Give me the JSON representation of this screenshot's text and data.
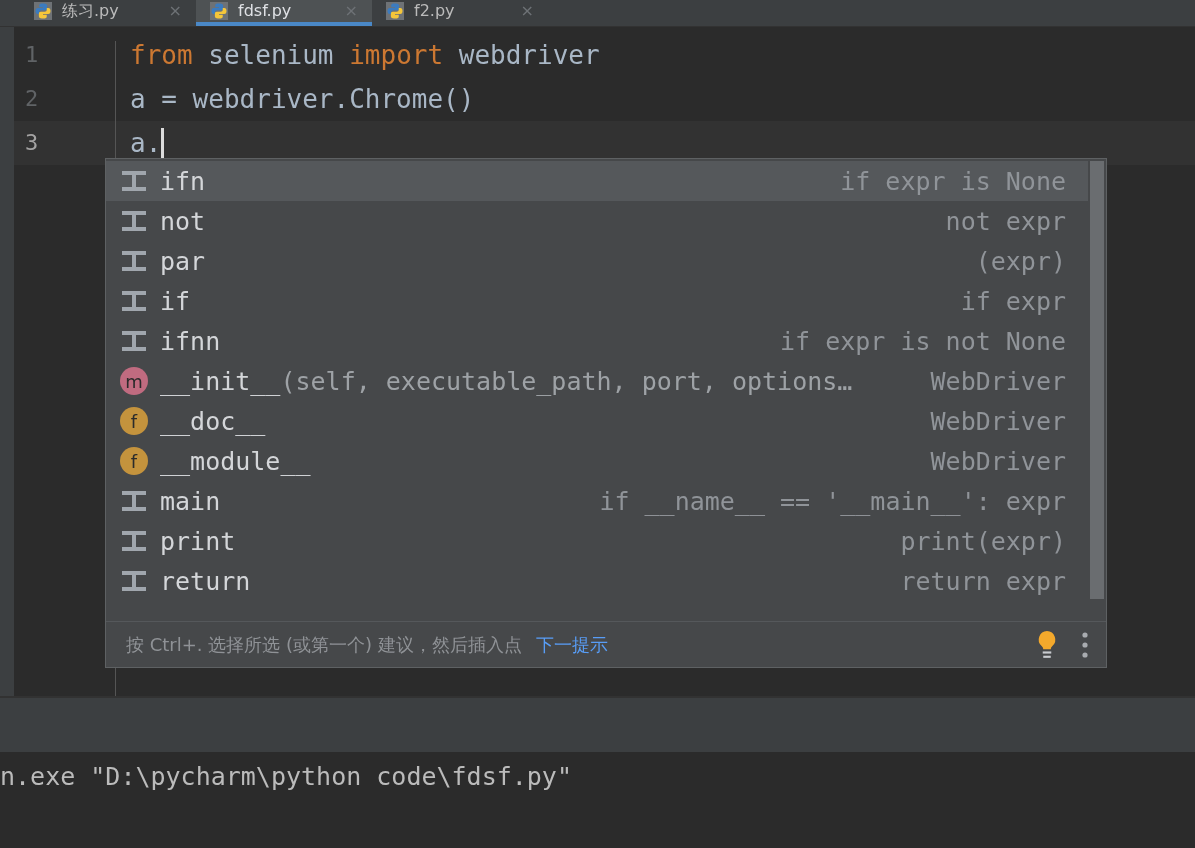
{
  "tabs": [
    {
      "label": "练习.py",
      "selected": false,
      "close": "×"
    },
    {
      "label": "fdsf.py",
      "selected": true,
      "close": "×"
    },
    {
      "label": "f2.py",
      "selected": false,
      "close": "×"
    }
  ],
  "editor": {
    "lines": [
      {
        "number": "1",
        "current": false,
        "tokens": [
          {
            "text": "from",
            "kind": "keyword"
          },
          {
            "text": " selenium ",
            "kind": "plain"
          },
          {
            "text": "import",
            "kind": "keyword"
          },
          {
            "text": " webdriver",
            "kind": "plain"
          }
        ]
      },
      {
        "number": "2",
        "current": false,
        "tokens": [
          {
            "text": "a = webdriver.Chrome()",
            "kind": "plain"
          }
        ]
      },
      {
        "number": "3",
        "current": true,
        "tokens": [
          {
            "text": "a.",
            "kind": "plain"
          }
        ]
      }
    ]
  },
  "completion": {
    "items": [
      {
        "kind": "template",
        "name": "ifn",
        "type": "if expr is None",
        "selected": true
      },
      {
        "kind": "template",
        "name": "not",
        "type": "not expr",
        "selected": false
      },
      {
        "kind": "template",
        "name": "par",
        "type": "(expr)",
        "selected": false
      },
      {
        "kind": "template",
        "name": "if",
        "type": "if expr",
        "selected": false
      },
      {
        "kind": "template",
        "name": "ifnn",
        "type": "if expr is not None",
        "selected": false
      },
      {
        "kind": "method",
        "icon": "m",
        "name": "__init__",
        "params": "(self, executable_path, port, options…",
        "type": "WebDriver",
        "selected": false
      },
      {
        "kind": "field",
        "icon": "f",
        "name": "__doc__",
        "type": "WebDriver",
        "selected": false
      },
      {
        "kind": "field",
        "icon": "f",
        "name": "__module__",
        "type": "WebDriver",
        "selected": false
      },
      {
        "kind": "template",
        "name": "main",
        "type": "if __name__ == '__main__': expr",
        "selected": false
      },
      {
        "kind": "template",
        "name": "print",
        "type": "print(expr)",
        "selected": false
      },
      {
        "kind": "template",
        "name": "return",
        "type": "return expr",
        "selected": false
      }
    ],
    "hint": "按 Ctrl+. 选择所选 (或第一个) 建议，然后插入点",
    "hint_link": "下一提示"
  },
  "console": {
    "text": "n.exe \"D:\\pycharm\\python code\\fdsf.py\""
  }
}
